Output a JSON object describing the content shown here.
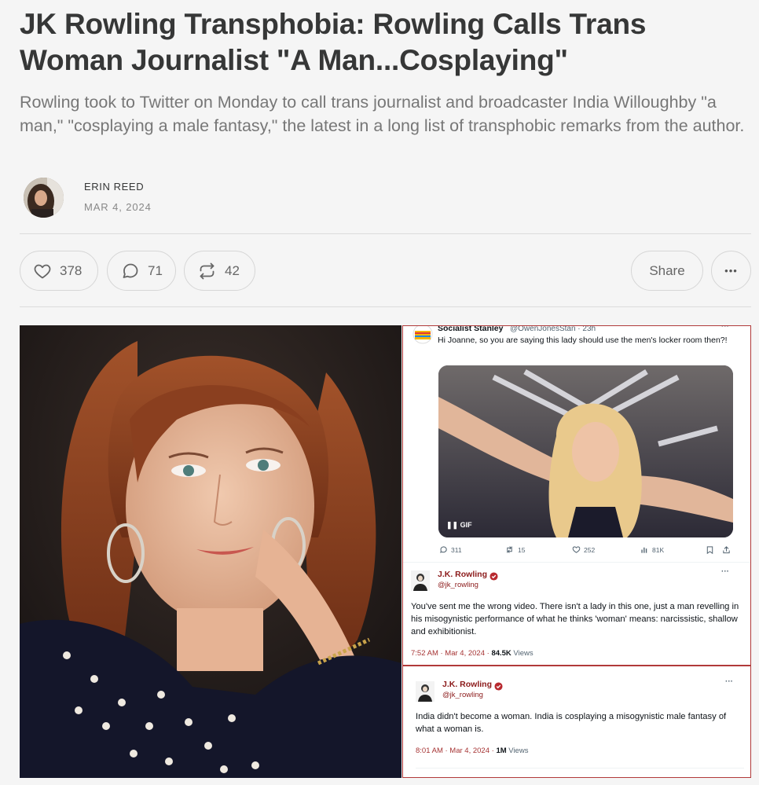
{
  "article": {
    "title": "JK Rowling Transphobia: Rowling Calls Trans Woman Journalist \"A Man...Cosplaying\"",
    "subtitle": "Rowling took to Twitter on Monday to call trans journalist and broadcaster India Willoughby \"a man,\" \"cosplaying a male fantasy,\" the latest in a long list of transphobic remarks from the author.",
    "author": "ERIN REED",
    "date": "MAR 4, 2024"
  },
  "actions": {
    "likes": "378",
    "comments": "71",
    "restacks": "42",
    "share_label": "Share",
    "more_label": "•••"
  },
  "embed": {
    "tweet1": {
      "name": "Socialist Stanley",
      "handle_time": "@OwenJonesStan · 23h",
      "text": "Hi Joanne, so you are saying this lady should use the men's locker room then?!",
      "media_badge": "GIF",
      "replies": "311",
      "retweets": "15",
      "likes": "252",
      "views": "81K"
    },
    "tweet2": {
      "name": "J.K. Rowling",
      "handle": "@jk_rowling",
      "text": "You've sent me the wrong video. There isn't a lady in this one, just a man revelling in his misogynistic performance of what he thinks 'woman' means: narcissistic, shallow and exhibitionist.",
      "timestamp": "7:52 AM · Mar 4, 2024 · ",
      "views_count": "84.5K",
      "views_label": " Views"
    },
    "tweet3": {
      "name": "J.K. Rowling",
      "handle": "@jk_rowling",
      "text": "India didn't become a woman. India is cosplaying a misogynistic male fantasy of what a woman is.",
      "timestamp": "8:01 AM · Mar 4, 2024 · ",
      "views_count": "1M",
      "views_label": " Views"
    }
  },
  "colors": {
    "text": "#363737",
    "muted": "#777777",
    "border": "#d6d6d6",
    "embed_border": "#b13a3a",
    "verified": "#b8292f"
  }
}
